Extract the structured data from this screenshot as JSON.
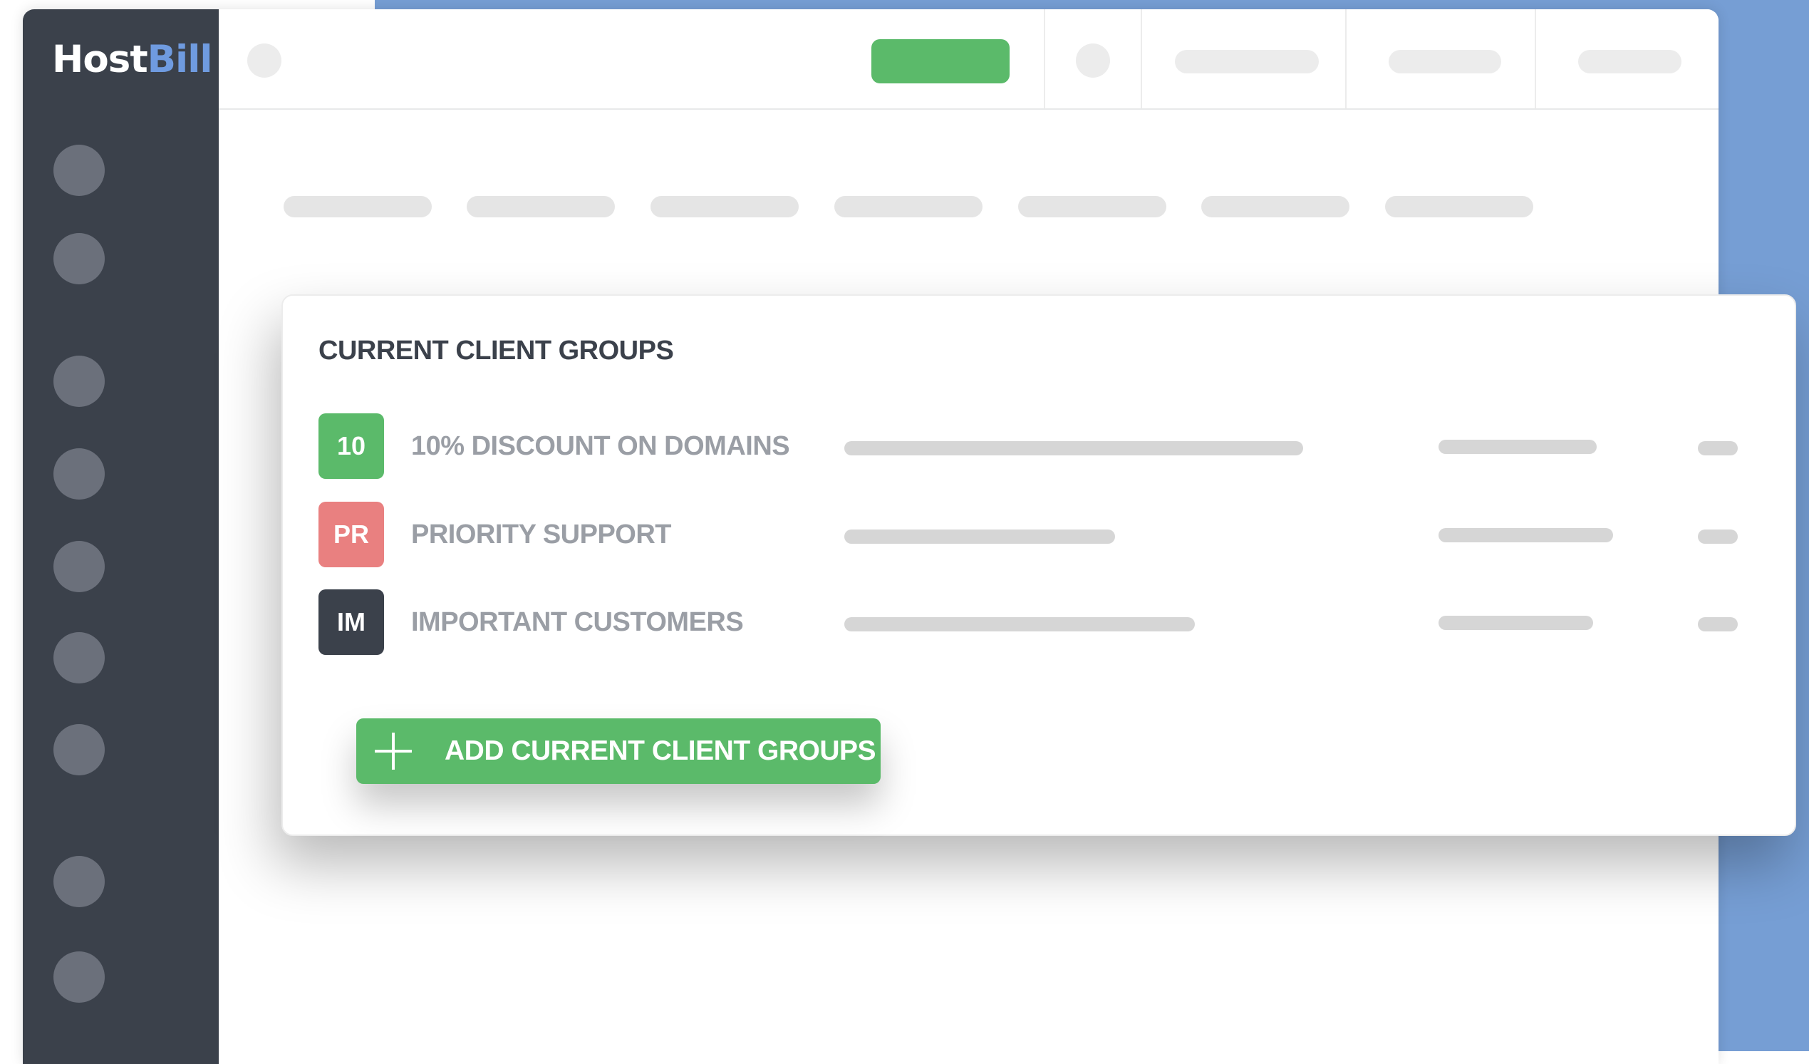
{
  "app": {
    "logo_host": "Host",
    "logo_bill": "Bill"
  },
  "colors": {
    "sidebar": "#3b414b",
    "accent_green": "#5bba6a",
    "badge_red": "#e98080",
    "badge_dark": "#3b414b",
    "background_blue": "#769ed4"
  },
  "card": {
    "title": "CURRENT CLIENT GROUPS",
    "groups": [
      {
        "badge": "10",
        "badge_color": "#5bba6a",
        "name": "10% DISCOUNT ON DOMAINS"
      },
      {
        "badge": "PR",
        "badge_color": "#e98080",
        "name": "PRIORITY SUPPORT"
      },
      {
        "badge": "IM",
        "badge_color": "#3b414b",
        "name": "IMPORTANT CUSTOMERS"
      }
    ],
    "add_button_label": "ADD CURRENT CLIENT GROUPS",
    "add_button_icon": "plus-icon"
  }
}
